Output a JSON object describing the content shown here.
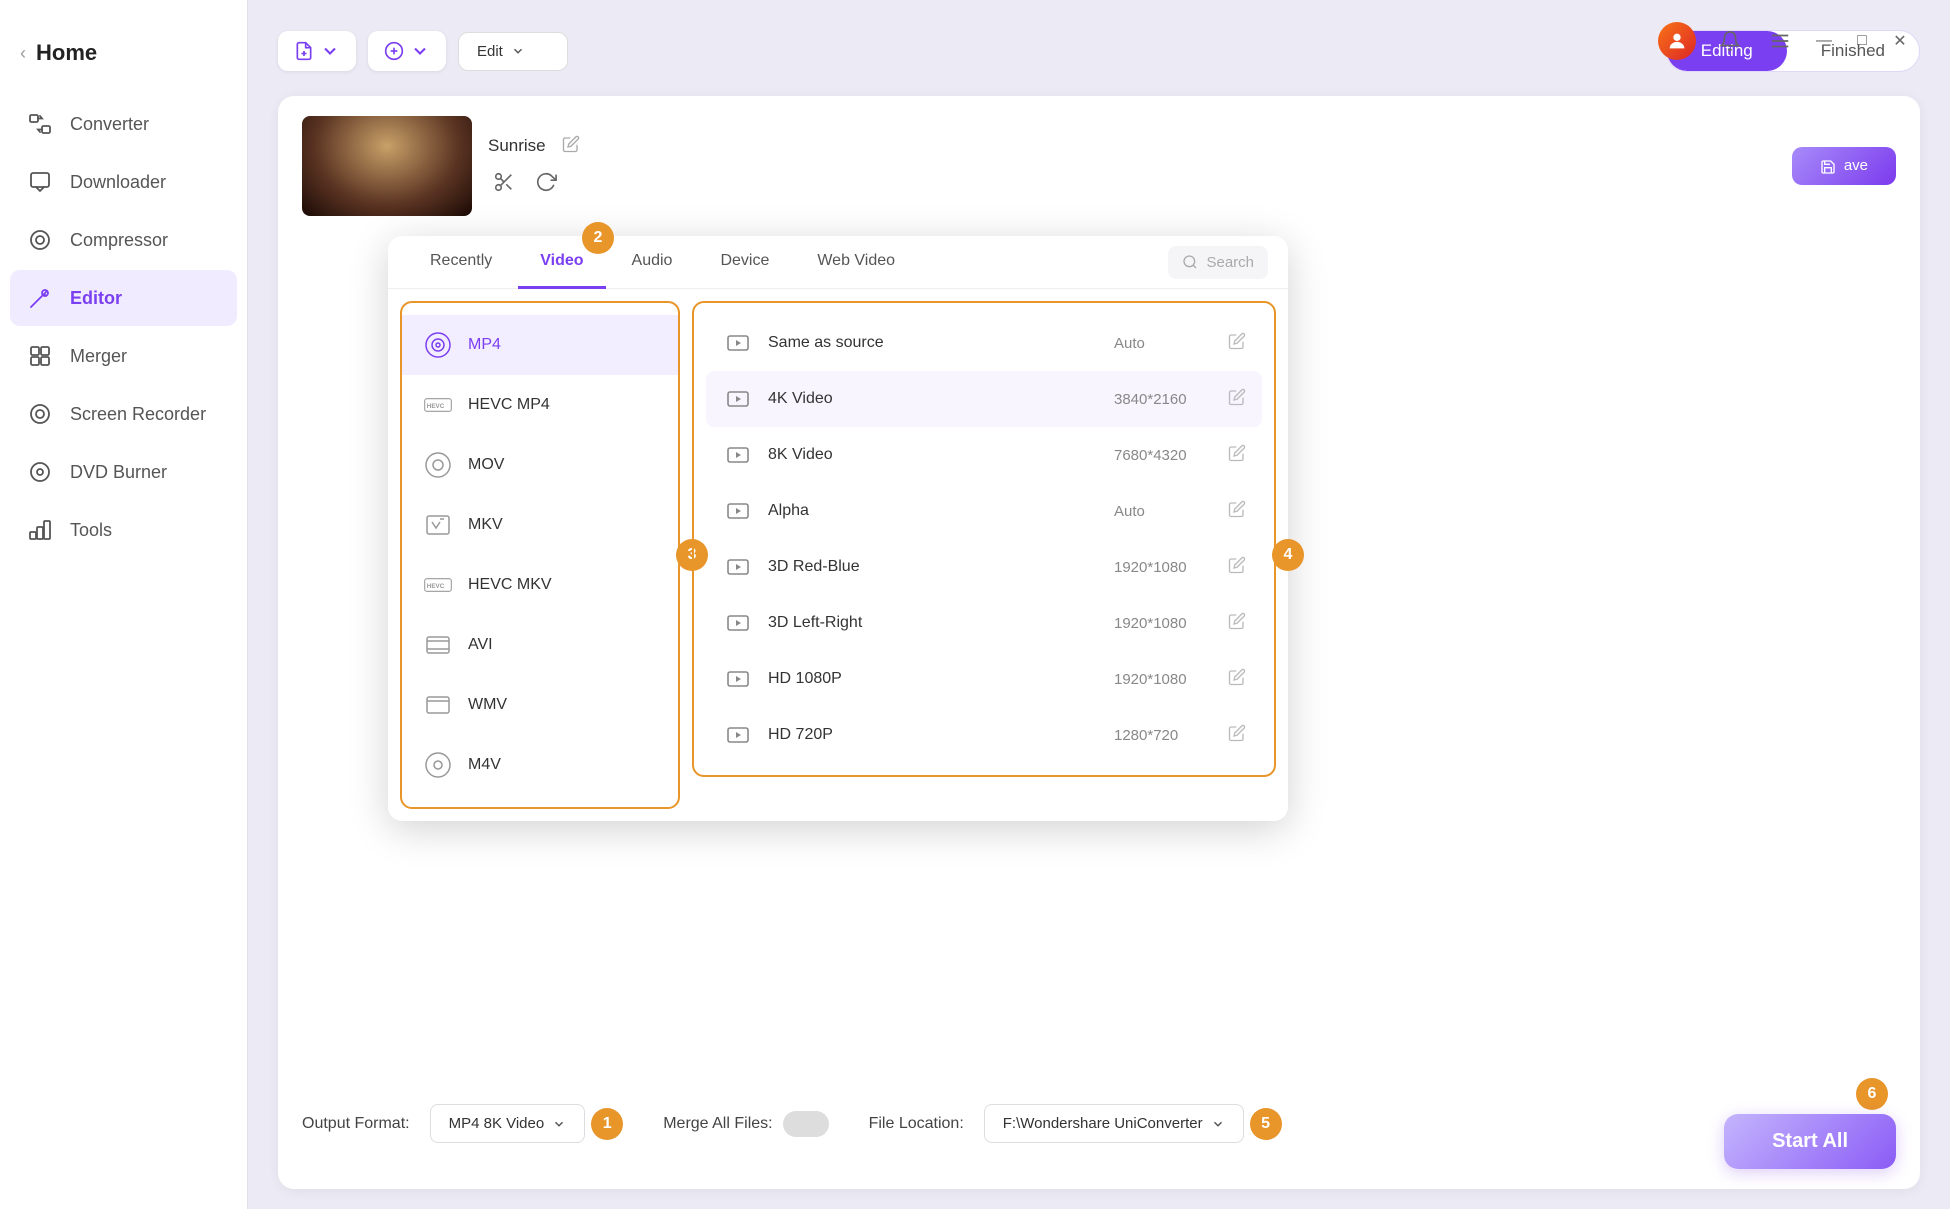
{
  "app": {
    "title": "Home"
  },
  "sidebar": {
    "items": [
      {
        "id": "converter",
        "label": "Converter",
        "icon": "⇄"
      },
      {
        "id": "downloader",
        "label": "Downloader",
        "icon": "↓"
      },
      {
        "id": "compressor",
        "label": "Compressor",
        "icon": "◎"
      },
      {
        "id": "editor",
        "label": "Editor",
        "icon": "✂",
        "active": true
      },
      {
        "id": "merger",
        "label": "Merger",
        "icon": "⊞"
      },
      {
        "id": "screen-recorder",
        "label": "Screen Recorder",
        "icon": "◉"
      },
      {
        "id": "dvd-burner",
        "label": "DVD Burner",
        "icon": "⊙"
      },
      {
        "id": "tools",
        "label": "Tools",
        "icon": "⚙"
      }
    ]
  },
  "toolbar": {
    "add_file_label": "",
    "add_url_label": "",
    "edit_dropdown_label": "Edit",
    "editing_label": "Editing",
    "finished_label": "Finished"
  },
  "video": {
    "title": "Sunrise",
    "controls": [
      "cut",
      "rotate"
    ],
    "save_label": "ave"
  },
  "format_picker": {
    "tabs": [
      {
        "id": "recently",
        "label": "Recently"
      },
      {
        "id": "video",
        "label": "Video",
        "active": true
      },
      {
        "id": "audio",
        "label": "Audio"
      },
      {
        "id": "device",
        "label": "Device"
      },
      {
        "id": "web-video",
        "label": "Web Video"
      }
    ],
    "search_placeholder": "Search",
    "badge2": "2",
    "formats": [
      {
        "id": "mp4",
        "label": "MP4",
        "selected": true
      },
      {
        "id": "hevc-mp4",
        "label": "HEVC MP4"
      },
      {
        "id": "mov",
        "label": "MOV"
      },
      {
        "id": "mkv",
        "label": "MKV"
      },
      {
        "id": "hevc-mkv",
        "label": "HEVC MKV"
      },
      {
        "id": "avi",
        "label": "AVI"
      },
      {
        "id": "wmv",
        "label": "WMV"
      },
      {
        "id": "m4v",
        "label": "M4V"
      }
    ],
    "badge3": "3",
    "resolutions": [
      {
        "id": "same-as-source",
        "label": "Same as source",
        "size": "Auto"
      },
      {
        "id": "4k-video",
        "label": "4K Video",
        "size": "3840*2160"
      },
      {
        "id": "8k-video",
        "label": "8K Video",
        "size": "7680*4320"
      },
      {
        "id": "alpha",
        "label": "Alpha",
        "size": "Auto"
      },
      {
        "id": "3d-red-blue",
        "label": "3D Red-Blue",
        "size": "1920*1080"
      },
      {
        "id": "3d-left-right",
        "label": "3D Left-Right",
        "size": "1920*1080"
      },
      {
        "id": "hd-1080p",
        "label": "HD 1080P",
        "size": "1920*1080"
      },
      {
        "id": "hd-720p",
        "label": "HD 720P",
        "size": "1280*720"
      }
    ],
    "badge4": "4"
  },
  "bottom": {
    "output_format_label": "Output Format:",
    "output_format_value": "MP4 8K Video",
    "badge1": "1",
    "merge_label": "Merge All Files:",
    "file_location_label": "File Location:",
    "file_location_value": "F:\\Wondershare UniConverter",
    "badge5": "5",
    "start_all_label": "Start All",
    "badge6": "6"
  },
  "window_controls": {
    "minimize": "—",
    "maximize": "□",
    "close": "✕"
  }
}
